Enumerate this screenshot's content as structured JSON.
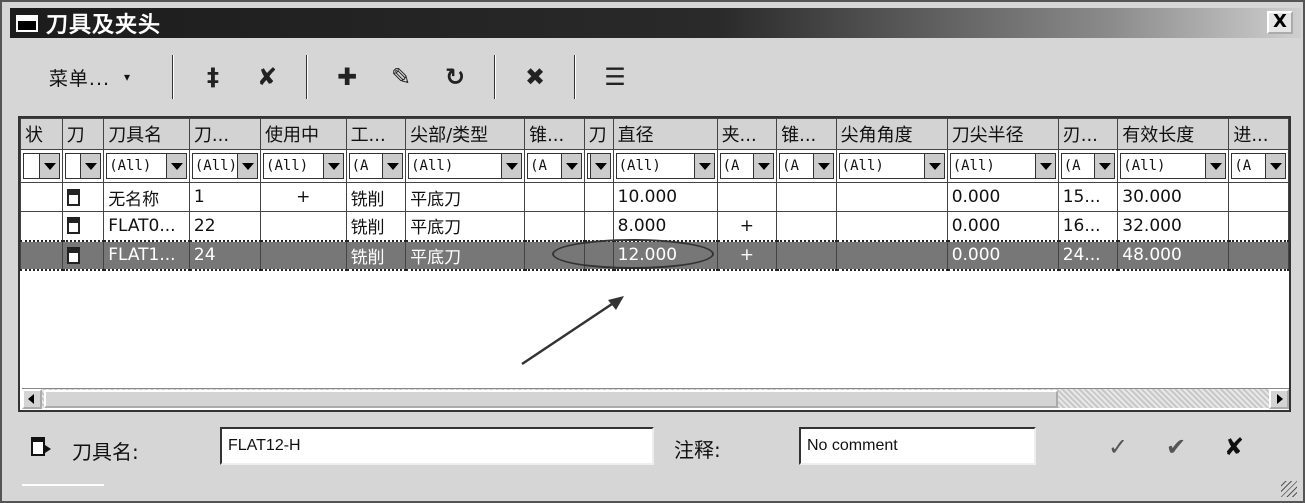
{
  "window": {
    "title": "刀具及夹头",
    "close_label": "X"
  },
  "toolbar": {
    "menu_label": "菜单...",
    "menu_arrow": "▾",
    "buttons": [
      {
        "name": "new-tool-button",
        "glyph": "‡"
      },
      {
        "name": "delete-tool-button",
        "glyph": "✘"
      },
      {
        "name": "add-holder-button",
        "glyph": "✚"
      },
      {
        "name": "edit-holder-button",
        "glyph": "✎"
      },
      {
        "name": "copy-holder-button",
        "glyph": "↻"
      },
      {
        "name": "clear-filter-button",
        "glyph": "✖"
      },
      {
        "name": "column-settings-button",
        "glyph": "☰"
      }
    ]
  },
  "table": {
    "columns": [
      "状",
      "刀",
      "刀具名",
      "刀...",
      "使用中",
      "工...",
      "尖部/类型",
      "锥...",
      "刀",
      "直径",
      "夹...",
      "锥...",
      "尖角角度",
      "刀尖半径",
      "刃...",
      "有效长度",
      "进..."
    ],
    "filters": [
      "",
      "",
      "(All)",
      "(All)",
      "(All)",
      "(A",
      "(All)",
      "(A",
      "",
      "(All)",
      "(A",
      "(A",
      "(All)",
      "(All)",
      "(A",
      "(All)",
      "(A"
    ],
    "rows": [
      [
        "",
        "",
        "无名称",
        "1",
        "+",
        "铣削",
        "平底刀",
        "",
        "",
        "10.000",
        "",
        "",
        "",
        "0.000",
        "15...",
        "30.000",
        ""
      ],
      [
        "",
        "",
        "FLAT0...",
        "22",
        "",
        "铣削",
        "平底刀",
        "",
        "",
        "8.000",
        "+",
        "",
        "",
        "0.000",
        "16...",
        "32.000",
        ""
      ],
      [
        "",
        "",
        "FLAT1...",
        "24",
        "",
        "铣削",
        "平底刀",
        "",
        "",
        "12.000",
        "+",
        "",
        "",
        "0.000",
        "24...",
        "48.000",
        ""
      ]
    ],
    "selected_row": 2
  },
  "bottom": {
    "tool_name_label": "刀具名:",
    "tool_name_value": "FLAT12-H",
    "comment_label": "注释:",
    "comment_value": "No comment"
  }
}
